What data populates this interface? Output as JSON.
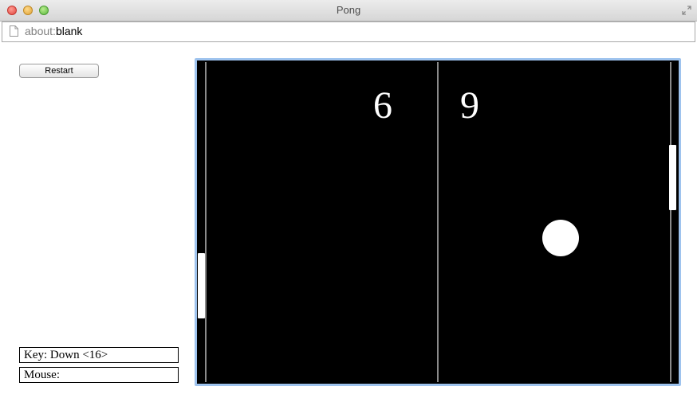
{
  "window": {
    "title": "Pong"
  },
  "urlbar": {
    "scheme": "about:",
    "path": "blank"
  },
  "controls": {
    "restart_label": "Restart"
  },
  "status": {
    "key_text": "Key: Down <16>",
    "mouse_text": "Mouse:"
  },
  "game": {
    "score_left": "6",
    "score_right": "9",
    "colors": {
      "background": "#000000",
      "foreground": "#ffffff",
      "court_lines": "#8a8a8a",
      "frame_focus": "#9ec3ee"
    }
  },
  "icons": {
    "close": "close-icon",
    "minimize": "minimize-icon",
    "zoom": "zoom-icon",
    "fullscreen": "fullscreen-icon",
    "page": "page-icon"
  }
}
